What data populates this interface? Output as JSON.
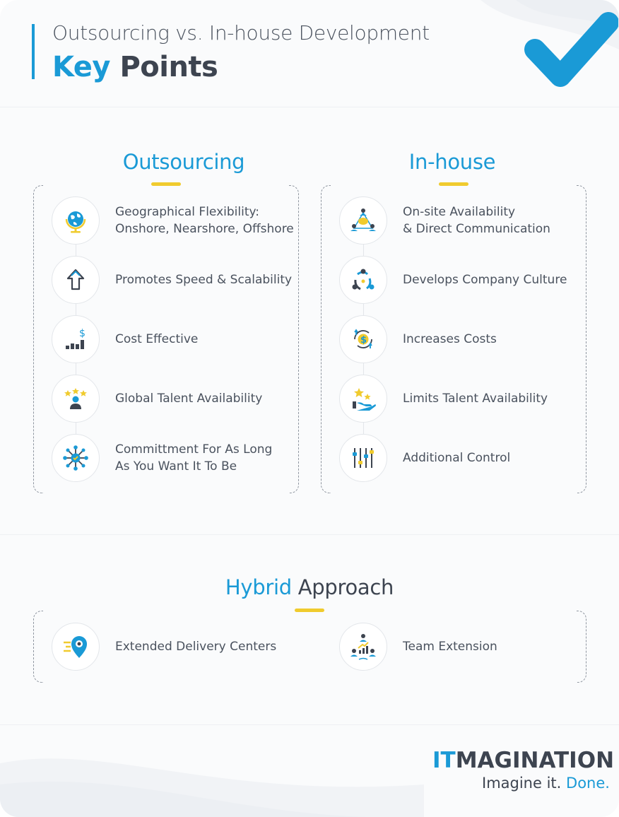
{
  "header": {
    "subtitle": "Outsourcing vs. In-house Development",
    "title_part1": "Key",
    "title_part2": "Points"
  },
  "outsourcing": {
    "title": "Outsourcing",
    "items": [
      {
        "label": "Geographical Flexibility:\nOnshore, Nearshore, Offshore",
        "icon": "globe-icon"
      },
      {
        "label": "Promotes Speed & Scalability",
        "icon": "arrow-up-icon"
      },
      {
        "label": "Cost Effective",
        "icon": "cost-chart-icon"
      },
      {
        "label": "Global Talent Availability",
        "icon": "talent-stars-icon"
      },
      {
        "label": "Committment For As Long\nAs You Want It To Be",
        "icon": "network-hub-icon"
      }
    ]
  },
  "inhouse": {
    "title": "In-house",
    "items": [
      {
        "label": "On-site Availability\n& Direct Communication",
        "icon": "team-chat-icon"
      },
      {
        "label": "Develops Company Culture",
        "icon": "culture-cycle-icon"
      },
      {
        "label": "Increases Costs",
        "icon": "dollar-cycle-icon"
      },
      {
        "label": "Limits Talent Availability",
        "icon": "hand-stars-icon"
      },
      {
        "label": "Additional Control",
        "icon": "sliders-icon"
      }
    ]
  },
  "hybrid": {
    "title_part1": "Hybrid",
    "title_part2": "Approach",
    "items": [
      {
        "label": "Extended Delivery Centers",
        "icon": "location-pin-icon"
      },
      {
        "label": "Team Extension",
        "icon": "team-growth-icon"
      }
    ]
  },
  "logo": {
    "it": "IT",
    "rest": "MAGINATION",
    "tag": "Imagine it.",
    "tag_done": "Done."
  },
  "colors": {
    "primary_blue": "#1a9ad6",
    "accent_yellow": "#f0cb2e",
    "dark_text": "#3d4450"
  }
}
